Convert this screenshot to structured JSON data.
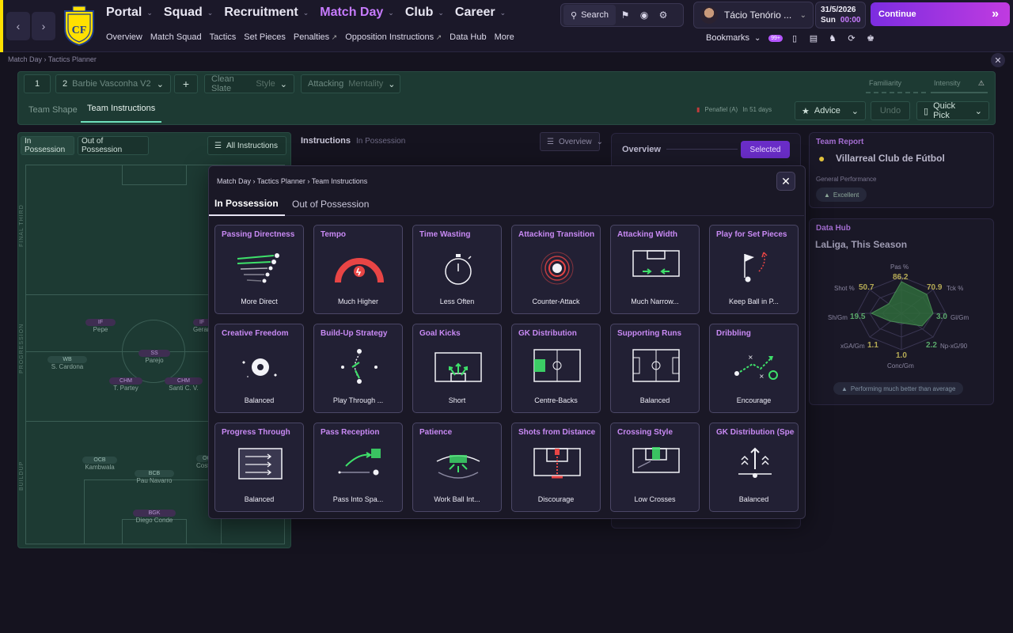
{
  "colors": {
    "accent": "#c77bff",
    "brand_yellow": "#ffe000",
    "pitch": "#1d3a33",
    "card_title": "#c98af5"
  },
  "topbar": {
    "nav": [
      {
        "label": "Portal",
        "active": false
      },
      {
        "label": "Squad",
        "active": false
      },
      {
        "label": "Recruitment",
        "active": false
      },
      {
        "label": "Match Day",
        "active": true
      },
      {
        "label": "Club",
        "active": false
      },
      {
        "label": "Career",
        "active": false
      }
    ],
    "subnav": [
      "Overview",
      "Match Squad",
      "Tactics",
      "Set Pieces",
      "Penalties",
      "Opposition Instructions",
      "Data Hub",
      "More"
    ],
    "search_label": "Search",
    "manager_name": "Tácio Tenório ...",
    "date": "31/5/2026",
    "day": "Sun",
    "time": "00:00",
    "continue_label": "Continue",
    "bookmarks_label": "Bookmarks",
    "notification_badge": "99+"
  },
  "breadcrumb": {
    "items": [
      "Match Day",
      "Tactics Planner"
    ]
  },
  "tactics": {
    "slot": "1",
    "tactic_number": "2",
    "tactic_name": "Barbie Vasconha V2",
    "style_value": "Clean Slate",
    "style_label": "Style",
    "mentality_value": "Attacking",
    "mentality_label": "Mentality",
    "familiarity_label": "Familiarity",
    "intensity_label": "Intensity",
    "tab_shape": "Team Shape",
    "tab_instructions": "Team Instructions",
    "next_match": "Penafiel (A)",
    "next_match_when": "In 51 days",
    "advice_label": "Advice",
    "undo_label": "Undo",
    "quick_pick_label": "Quick Pick"
  },
  "pitch": {
    "toggle_in": "In Possession",
    "toggle_out": "Out of Possession",
    "all_instructions": "All Instructions",
    "zones": [
      "FINAL THIRD",
      "PROGRESSION",
      "BUILDUP"
    ],
    "players": [
      {
        "role": "IF",
        "name": "Pepe",
        "kind": "att"
      },
      {
        "role": "IF",
        "name": "Gerard",
        "kind": "att"
      },
      {
        "role": "SS",
        "name": "Parejo",
        "kind": "att"
      },
      {
        "role": "WB",
        "name": "S. Cardona",
        "kind": "def"
      },
      {
        "role": "CHM",
        "name": "T. Partey",
        "kind": "att"
      },
      {
        "role": "CHM",
        "name": "Santi C. V.",
        "kind": "att"
      },
      {
        "role": "OCB",
        "name": "Kambwala",
        "kind": "def"
      },
      {
        "role": "BCB",
        "name": "Pau Navarro",
        "kind": "def"
      },
      {
        "role": "OCB",
        "name": "Costa",
        "kind": "def"
      },
      {
        "role": "BGK",
        "name": "Diego Conde",
        "kind": "att"
      }
    ]
  },
  "instructions_panel": {
    "title": "Instructions",
    "subtitle": "In Possession",
    "view": "Overview",
    "overview_label": "Overview",
    "selected_label": "Selected"
  },
  "team_report": {
    "title": "Team Report",
    "club": "Villarreal Club de Fútbol",
    "section": "General Performance",
    "rating": "Excellent"
  },
  "data_hub": {
    "title": "Data Hub",
    "scope": "LaLiga, This Season",
    "stats": [
      {
        "label": "Pas %",
        "value": "86.2"
      },
      {
        "label": "Tck %",
        "value": "70.9"
      },
      {
        "label": "Gl/Gm",
        "value": "3.0"
      },
      {
        "label": "Np-xG/90",
        "value": "2.2"
      },
      {
        "label": "Conc/Gm",
        "value": "1.0"
      },
      {
        "label": "xGA/Gm",
        "value": "1.1"
      },
      {
        "label": "Sh/Gm",
        "value": "19.5"
      },
      {
        "label": "Shot %",
        "value": "50.7"
      }
    ],
    "summary": "Performing much better than average"
  },
  "modal": {
    "crumbs": [
      "Match Day",
      "Tactics Planner",
      "Team Instructions"
    ],
    "tab_in": "In Possession",
    "tab_out": "Out of Possession",
    "cards": [
      {
        "title": "Passing Directness",
        "value": "More Direct",
        "icon": "passing-directness-icon"
      },
      {
        "title": "Tempo",
        "value": "Much Higher",
        "icon": "tempo-gauge-icon"
      },
      {
        "title": "Time Wasting",
        "value": "Less Often",
        "icon": "stopwatch-icon"
      },
      {
        "title": "Attacking Transition",
        "value": "Counter-Attack",
        "icon": "transition-target-icon"
      },
      {
        "title": "Attacking Width",
        "value": "Much Narrow...",
        "icon": "attacking-width-icon"
      },
      {
        "title": "Play for Set Pieces",
        "value": "Keep Ball in P...",
        "icon": "set-piece-flag-icon"
      },
      {
        "title": "Creative Freedom",
        "value": "Balanced",
        "icon": "creative-ball-icon"
      },
      {
        "title": "Build-Up Strategy",
        "value": "Play Through ...",
        "icon": "build-up-icon"
      },
      {
        "title": "Goal Kicks",
        "value": "Short",
        "icon": "goal-kicks-icon"
      },
      {
        "title": "GK Distribution",
        "value": "Centre-Backs",
        "icon": "gk-distribution-icon"
      },
      {
        "title": "Supporting Runs",
        "value": "Balanced",
        "icon": "supporting-runs-icon"
      },
      {
        "title": "Dribbling",
        "value": "Encourage",
        "icon": "dribbling-icon"
      },
      {
        "title": "Progress Through",
        "value": "Balanced",
        "icon": "progress-through-icon"
      },
      {
        "title": "Pass Reception",
        "value": "Pass Into Spa...",
        "icon": "pass-reception-icon"
      },
      {
        "title": "Patience",
        "value": "Work Ball Int...",
        "icon": "patience-icon"
      },
      {
        "title": "Shots from Distance",
        "value": "Discourage",
        "icon": "shots-distance-icon"
      },
      {
        "title": "Crossing Style",
        "value": "Low Crosses",
        "icon": "crossing-style-icon"
      },
      {
        "title": "GK Distribution (Speed",
        "value": "Balanced",
        "icon": "gk-speed-icon"
      }
    ]
  }
}
